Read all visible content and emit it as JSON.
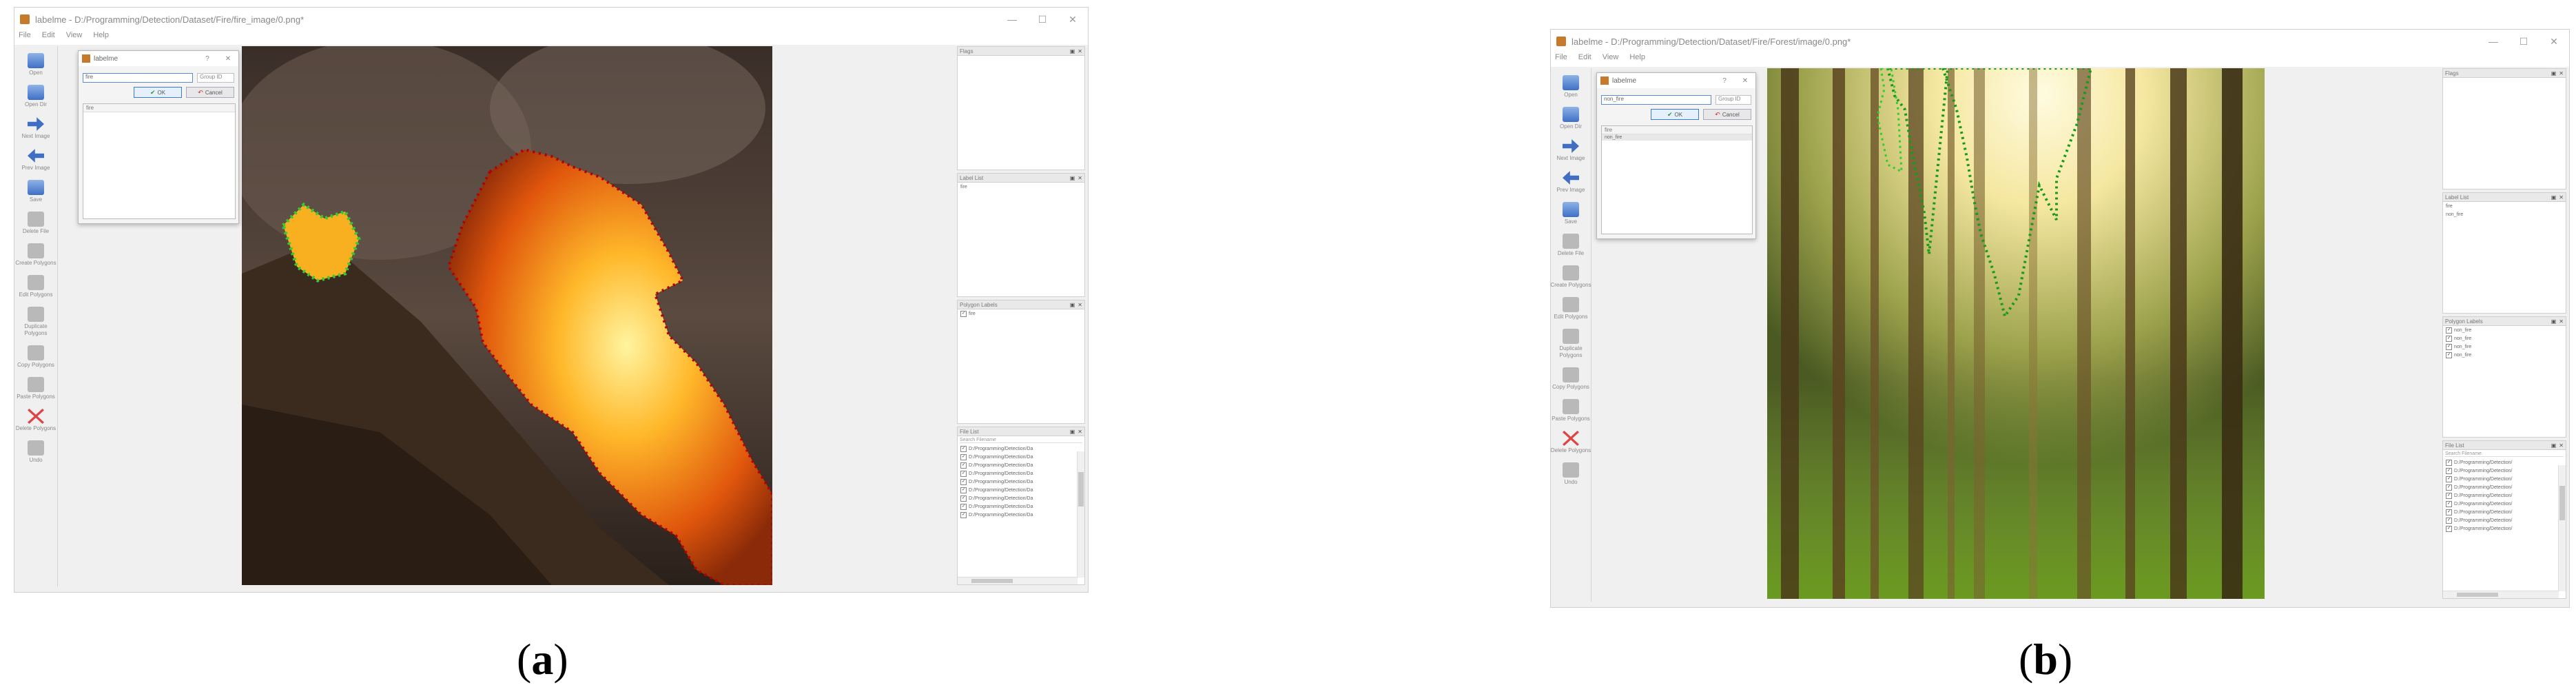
{
  "figure": {
    "panel_a": {
      "caption_open": "(",
      "caption_letter": "a",
      "caption_close": ")",
      "window_title": "labelme - D:/Programming/Detection/Dataset/Fire/fire_image/0.png*",
      "window_buttons": [
        "—",
        "☐",
        "✕"
      ],
      "menu": [
        "File",
        "Edit",
        "View",
        "Help"
      ],
      "toolbar": [
        {
          "label": "Open",
          "icon": "open-folder-icon"
        },
        {
          "label": "Open Dir",
          "icon": "open-dir-icon"
        },
        {
          "label": "Next Image",
          "icon": "next-arrow-icon"
        },
        {
          "label": "Prev Image",
          "icon": "prev-arrow-icon"
        },
        {
          "label": "Save",
          "icon": "save-icon"
        },
        {
          "label": "Delete File",
          "icon": "delete-file-icon"
        },
        {
          "label": "Create Polygons",
          "icon": "polygon-icon"
        },
        {
          "label": "Edit Polygons",
          "icon": "edit-icon"
        },
        {
          "label": "Duplicate Polygons",
          "icon": "duplicate-icon"
        },
        {
          "label": "Copy Polygons",
          "icon": "copy-icon"
        },
        {
          "label": "Paste Polygons",
          "icon": "paste-icon"
        },
        {
          "label": "Delete Polygons",
          "icon": "delete-icon"
        },
        {
          "label": "Undo",
          "icon": "undo-icon"
        }
      ],
      "dialog": {
        "title": "labelme",
        "help": "?",
        "close": "✕",
        "input_value": "fire",
        "group_placeholder": "Group ID",
        "ok": "OK",
        "cancel": "Cancel",
        "list_header": "fire",
        "list_items": []
      },
      "dock": {
        "flags_title": "Flags",
        "labels_title": "Label List",
        "labels": [
          "fire"
        ],
        "polygons_title": "Polygon Labels",
        "polygons": [
          "fire"
        ],
        "files_title": "File List",
        "files_search": "Search Filename",
        "files": [
          "D:/Programming/Detection/Da",
          "D:/Programming/Detection/Da",
          "D:/Programming/Detection/Da",
          "D:/Programming/Detection/Da",
          "D:/Programming/Detection/Da",
          "D:/Programming/Detection/Da",
          "D:/Programming/Detection/Da",
          "D:/Programming/Detection/Da",
          "D:/Programming/Detection/Da"
        ]
      },
      "colors": {
        "red_polygon": "#b40000",
        "green_polygon": "#33cc33"
      }
    },
    "panel_b": {
      "caption_open": "(",
      "caption_letter": "b",
      "caption_close": ")",
      "window_title": "labelme - D:/Programming/Detection/Dataset/Fire/Forest/image/0.png*",
      "window_buttons": [
        "—",
        "☐",
        "✕"
      ],
      "menu": [
        "File",
        "Edit",
        "View",
        "Help"
      ],
      "toolbar": [
        {
          "label": "Open",
          "icon": "open-folder-icon"
        },
        {
          "label": "Open Dir",
          "icon": "open-dir-icon"
        },
        {
          "label": "Next Image",
          "icon": "next-arrow-icon"
        },
        {
          "label": "Prev Image",
          "icon": "prev-arrow-icon"
        },
        {
          "label": "Save",
          "icon": "save-icon"
        },
        {
          "label": "Delete File",
          "icon": "delete-file-icon"
        },
        {
          "label": "Create Polygons",
          "icon": "polygon-icon"
        },
        {
          "label": "Edit Polygons",
          "icon": "edit-icon"
        },
        {
          "label": "Duplicate Polygons",
          "icon": "duplicate-icon"
        },
        {
          "label": "Copy Polygons",
          "icon": "copy-icon"
        },
        {
          "label": "Paste Polygons",
          "icon": "paste-icon"
        },
        {
          "label": "Delete Polygons",
          "icon": "delete-icon"
        },
        {
          "label": "Undo",
          "icon": "undo-icon"
        }
      ],
      "dialog": {
        "title": "labelme",
        "help": "?",
        "close": "✕",
        "input_value": "non_fire",
        "group_placeholder": "Group ID",
        "ok": "OK",
        "cancel": "Cancel",
        "list_header": "fire",
        "list_items": [
          "non_fire"
        ]
      },
      "dock": {
        "flags_title": "Flags",
        "labels_title": "Label List",
        "labels": [
          "fire",
          "non_fire"
        ],
        "polygons_title": "Polygon Labels",
        "polygons": [
          "non_fire",
          "non_fire",
          "non_fire",
          "non_fire"
        ],
        "files_title": "File List",
        "files_search": "Search Filename",
        "files": [
          "D:/Programming/Detection/",
          "D:/Programming/Detection/",
          "D:/Programming/Detection/",
          "D:/Programming/Detection/",
          "D:/Programming/Detection/",
          "D:/Programming/Detection/",
          "D:/Programming/Detection/",
          "D:/Programming/Detection/",
          "D:/Programming/Detection/"
        ]
      },
      "colors": {
        "green_polygon": "#1a9a1a"
      }
    }
  }
}
